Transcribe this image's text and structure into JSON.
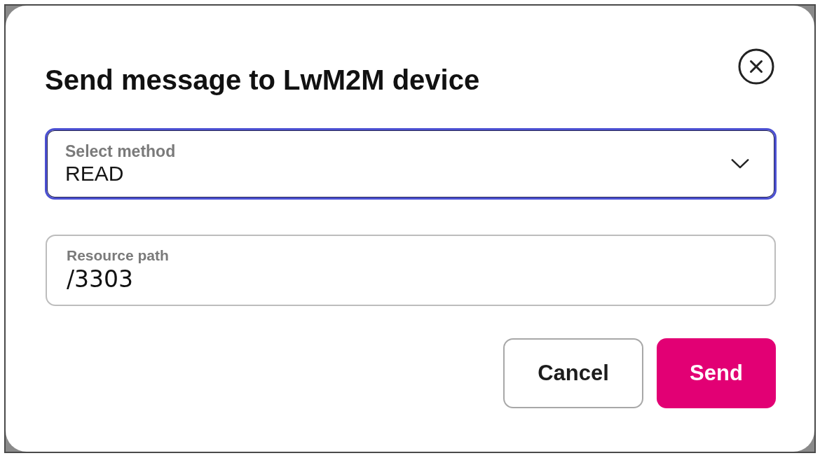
{
  "dialog": {
    "title": "Send message to LwM2M device",
    "fields": [
      {
        "kind": "select",
        "label": "Select method",
        "value": "READ",
        "focused": true
      },
      {
        "kind": "text",
        "label": "Resource path",
        "value": "/3303",
        "focused": false
      }
    ],
    "buttons": [
      {
        "kind": "secondary",
        "label": "Cancel"
      },
      {
        "kind": "primary",
        "label": "Send"
      }
    ]
  }
}
